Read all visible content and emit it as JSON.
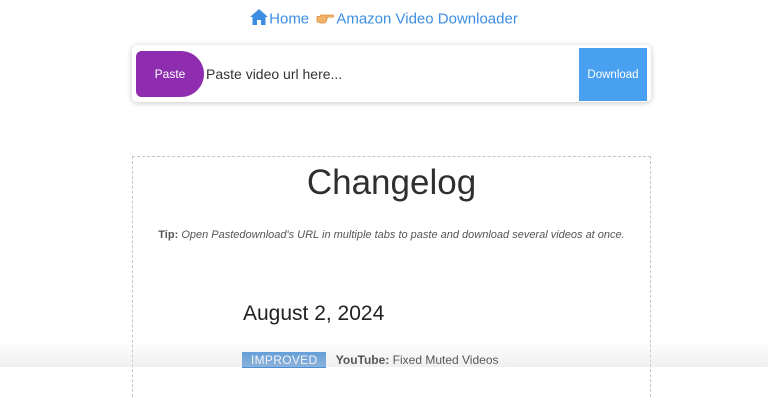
{
  "breadcrumb": {
    "home_icon": "home-icon",
    "home_label": "Home",
    "separator_icon": "pointing-hand-icon",
    "current_label": "Amazon Video Downloader",
    "link_color": "#3d8ee3"
  },
  "url_bar": {
    "paste_label": "Paste",
    "paste_color": "#8e2db0",
    "placeholder": "Paste video url here...",
    "value": "",
    "download_label": "Download",
    "download_color": "#4aa0f0"
  },
  "changelog": {
    "title": "Changelog",
    "tip_label": "Tip:",
    "tip_text": "Open Pastedownload's URL in multiple tabs to paste and download several videos at once.",
    "entries": [
      {
        "date": "August 2, 2024",
        "items": [
          {
            "badge": "IMPROVED",
            "badge_color": "#4a90d9",
            "product": "YouTube:",
            "text": "Fixed Muted Videos"
          }
        ]
      }
    ]
  }
}
